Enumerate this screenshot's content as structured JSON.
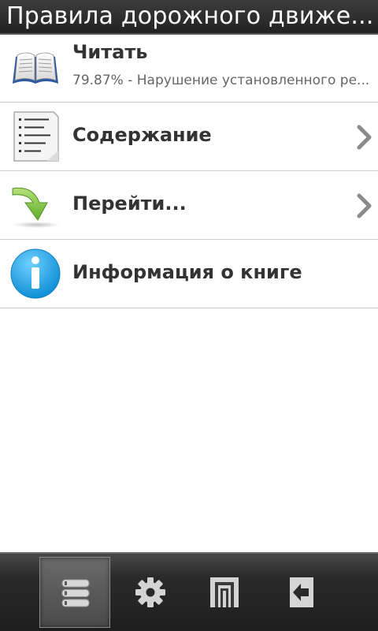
{
  "app": {
    "title": "Правила дорожного движе..."
  },
  "menu": {
    "items": [
      {
        "label": "Читать",
        "sublabel": "79.87% - Нарушение установленного ре...",
        "icon": "book-icon"
      },
      {
        "label": "Содержание",
        "icon": "document-list-icon",
        "has_chevron": true
      },
      {
        "label": "Перейти...",
        "icon": "green-arrow-icon",
        "has_chevron": true
      },
      {
        "label": "Информация о книге",
        "icon": "info-icon"
      }
    ]
  },
  "toolbar": {
    "buttons": [
      {
        "icon": "list-icon",
        "active": true
      },
      {
        "icon": "gear-icon"
      },
      {
        "icon": "library-icon"
      },
      {
        "icon": "exit-icon"
      }
    ]
  },
  "colors": {
    "titlebar_bg": "#2a2a2a",
    "title_text": "#ffffff",
    "list_bg": "#ffffff",
    "label_text": "#333333",
    "sublabel_text": "#666666",
    "divider": "#cfcfcf",
    "toolbar_bg": "#222222",
    "info_blue": "#1ea5e6",
    "arrow_green": "#7cc242"
  }
}
